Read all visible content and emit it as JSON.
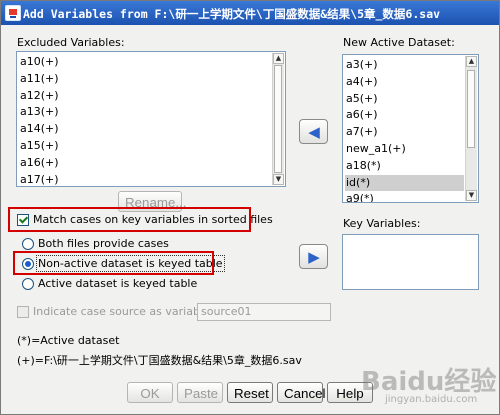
{
  "window": {
    "title": "Add Variables from F:\\研一上学期文件\\丁国盛数据&结果\\5章_数据6.sav"
  },
  "excluded": {
    "label": "Excluded Variables:",
    "items": [
      "a10(+)",
      "a11(+)",
      "a12(+)",
      "a13(+)",
      "a14(+)",
      "a15(+)",
      "a16(+)",
      "a17(+)"
    ]
  },
  "active": {
    "label": "New Active Dataset:",
    "items": [
      "a3(+)",
      "a4(+)",
      "a5(+)",
      "a6(+)",
      "a7(+)",
      "new_a1(+)",
      "a18(*)",
      "id(*)",
      "a9(*)"
    ],
    "selected_item": "id(*)"
  },
  "key_variables": {
    "label": "Key Variables:",
    "items": []
  },
  "rename_button": "Rename...",
  "match_cases": {
    "label": "Match cases on key variables in sorted files",
    "checked": true
  },
  "radios": [
    {
      "label": "Both files provide cases",
      "checked": false
    },
    {
      "label": "Non-active dataset is keyed table",
      "checked": true
    },
    {
      "label": "Active dataset is keyed table",
      "checked": false
    }
  ],
  "indicate_source": {
    "label": "Indicate case source as variable:",
    "value": "source01",
    "enabled": false
  },
  "legend": {
    "active_note": "(*)=Active dataset",
    "source_note": "(+)=F:\\研一上学期文件\\丁国盛数据&结果\\5章_数据6.sav"
  },
  "buttons": {
    "ok": "OK",
    "paste": "Paste",
    "reset": "Reset",
    "cancel": "Cancel",
    "help": "Help"
  },
  "watermark": {
    "brand": "Baidu经验",
    "sub": "jingyan.baidu.com"
  },
  "colors": {
    "highlight_box": "#d40000",
    "title_bar": "#1c52b0"
  }
}
